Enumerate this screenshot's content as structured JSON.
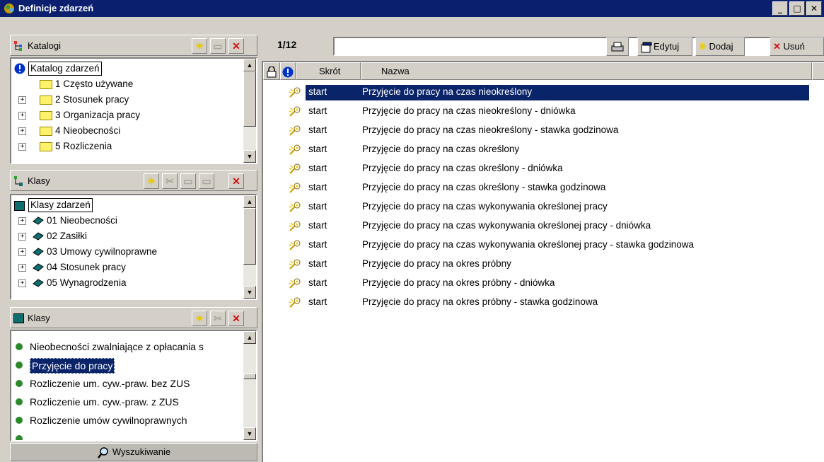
{
  "window": {
    "title": "Definicje zdarzeń",
    "minimize_glyph": "_",
    "maximize_glyph": "□",
    "close_glyph": "✕"
  },
  "katalogi": {
    "header": "Katalogi",
    "root": "Katalog zdarzeń",
    "items": [
      {
        "label": "1 Często używane"
      },
      {
        "label": "2 Stosunek pracy"
      },
      {
        "label": "3 Organizacja pracy"
      },
      {
        "label": "4 Nieobecności"
      },
      {
        "label": "5 Rozliczenia"
      }
    ]
  },
  "klasy_tree": {
    "header": "Klasy",
    "root": "Klasy zdarzeń",
    "items": [
      {
        "label": "01 Nieobecności"
      },
      {
        "label": "02 Zasiłki"
      },
      {
        "label": "03 Umowy cywilnoprawne"
      },
      {
        "label": "04 Stosunek pracy"
      },
      {
        "label": "05 Wynagrodzenia"
      }
    ]
  },
  "klasy_list": {
    "header": "Klasy",
    "items": [
      {
        "label": "Nieobecności zwalniające z opłacania s"
      },
      {
        "label": "Przyjęcie do pracy"
      },
      {
        "label": "Rozliczenie um. cyw.-praw. bez ZUS"
      },
      {
        "label": "Rozliczenie um. cyw.-praw. z ZUS"
      },
      {
        "label": "Rozliczenie umów cywilnoprawnych"
      }
    ],
    "selected_index": 1
  },
  "search_button": "Wyszukiwanie",
  "toolbar": {
    "counter": "1/12",
    "filter_value": "",
    "edit_label": "Edytuj",
    "add_label": "Dodaj",
    "delete_label": "Usuń"
  },
  "list": {
    "columns": {
      "skrot": "Skrót",
      "nazwa": "Nazwa"
    },
    "rows": [
      {
        "skrot": "start",
        "nazwa": "Przyjęcie do pracy na czas nieokreślony"
      },
      {
        "skrot": "start",
        "nazwa": "Przyjęcie do pracy na czas nieokreślony - dniówka"
      },
      {
        "skrot": "start",
        "nazwa": "Przyjęcie do pracy na czas nieokreślony - stawka godzinowa"
      },
      {
        "skrot": "start",
        "nazwa": "Przyjęcie do pracy na czas określony"
      },
      {
        "skrot": "start",
        "nazwa": "Przyjęcie do pracy na czas określony - dniówka"
      },
      {
        "skrot": "start",
        "nazwa": "Przyjęcie do pracy na czas określony - stawka godzinowa"
      },
      {
        "skrot": "start",
        "nazwa": "Przyjęcie do pracy na czas wykonywania określonej pracy"
      },
      {
        "skrot": "start",
        "nazwa": "Przyjęcie do pracy na czas wykonywania określonej pracy - dniówka"
      },
      {
        "skrot": "start",
        "nazwa": "Przyjęcie do pracy na czas wykonywania określonej pracy - stawka godzinowa"
      },
      {
        "skrot": "start",
        "nazwa": "Przyjęcie do pracy na okres próbny"
      },
      {
        "skrot": "start",
        "nazwa": "Przyjęcie do pracy na okres próbny - dniówka"
      },
      {
        "skrot": "start",
        "nazwa": "Przyjęcie do pracy na okres próbny - stawka godzinowa"
      }
    ],
    "selected_index": 0
  },
  "colors": {
    "titlebar": "#0a1f6e",
    "selection": "#0a246a",
    "delete_red": "#d01010",
    "folder_yellow": "#fff16a",
    "book_teal": "#0f6e6e",
    "dot_green": "#2a8a2a"
  }
}
